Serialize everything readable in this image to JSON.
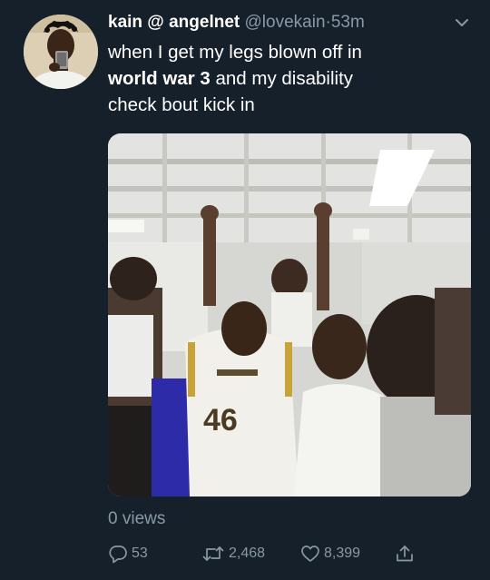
{
  "tweet": {
    "display_name": "kain @ angelnet",
    "handle": "@lovekain",
    "separator": "·",
    "time": "53m",
    "text_line1": "when I get my legs blown off in",
    "text_bold": "world war 3",
    "text_line2_rest": " and my disability",
    "text_line3": "check bout kick in",
    "views": "0 views",
    "jersey_number": "46"
  },
  "actions": {
    "reply_count": "53",
    "retweet_count": "2,468",
    "like_count": "8,399"
  },
  "icons": {
    "caret": "chevron-down-icon",
    "reply": "reply-icon",
    "retweet": "retweet-icon",
    "like": "heart-icon",
    "share": "share-icon"
  },
  "colors": {
    "background": "#15202b",
    "primary_text": "#ffffff",
    "secondary_text": "#8899a6"
  }
}
